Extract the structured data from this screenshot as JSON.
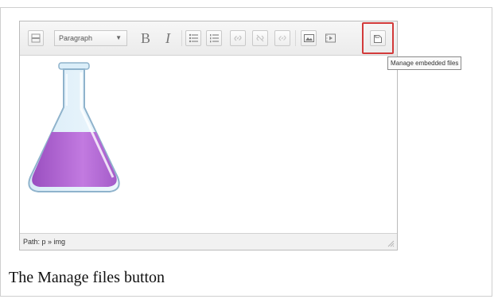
{
  "toolbar": {
    "format_select": "Paragraph",
    "bold_glyph": "B",
    "italic_glyph": "I"
  },
  "tooltip": {
    "text": "Manage embedded files"
  },
  "statusbar": {
    "path": "Path: p » img"
  },
  "caption": {
    "text": "The Manage files button"
  },
  "colors": {
    "highlight": "#d23a3a",
    "flask_liquid": "#b86ad6"
  },
  "icons": [
    "toggle-toolbar-icon",
    "unordered-list-icon",
    "ordered-list-icon",
    "link-icon",
    "unlink-icon",
    "anchor-icon",
    "image-icon",
    "media-icon",
    "manage-files-icon",
    "resize-grip-icon"
  ]
}
